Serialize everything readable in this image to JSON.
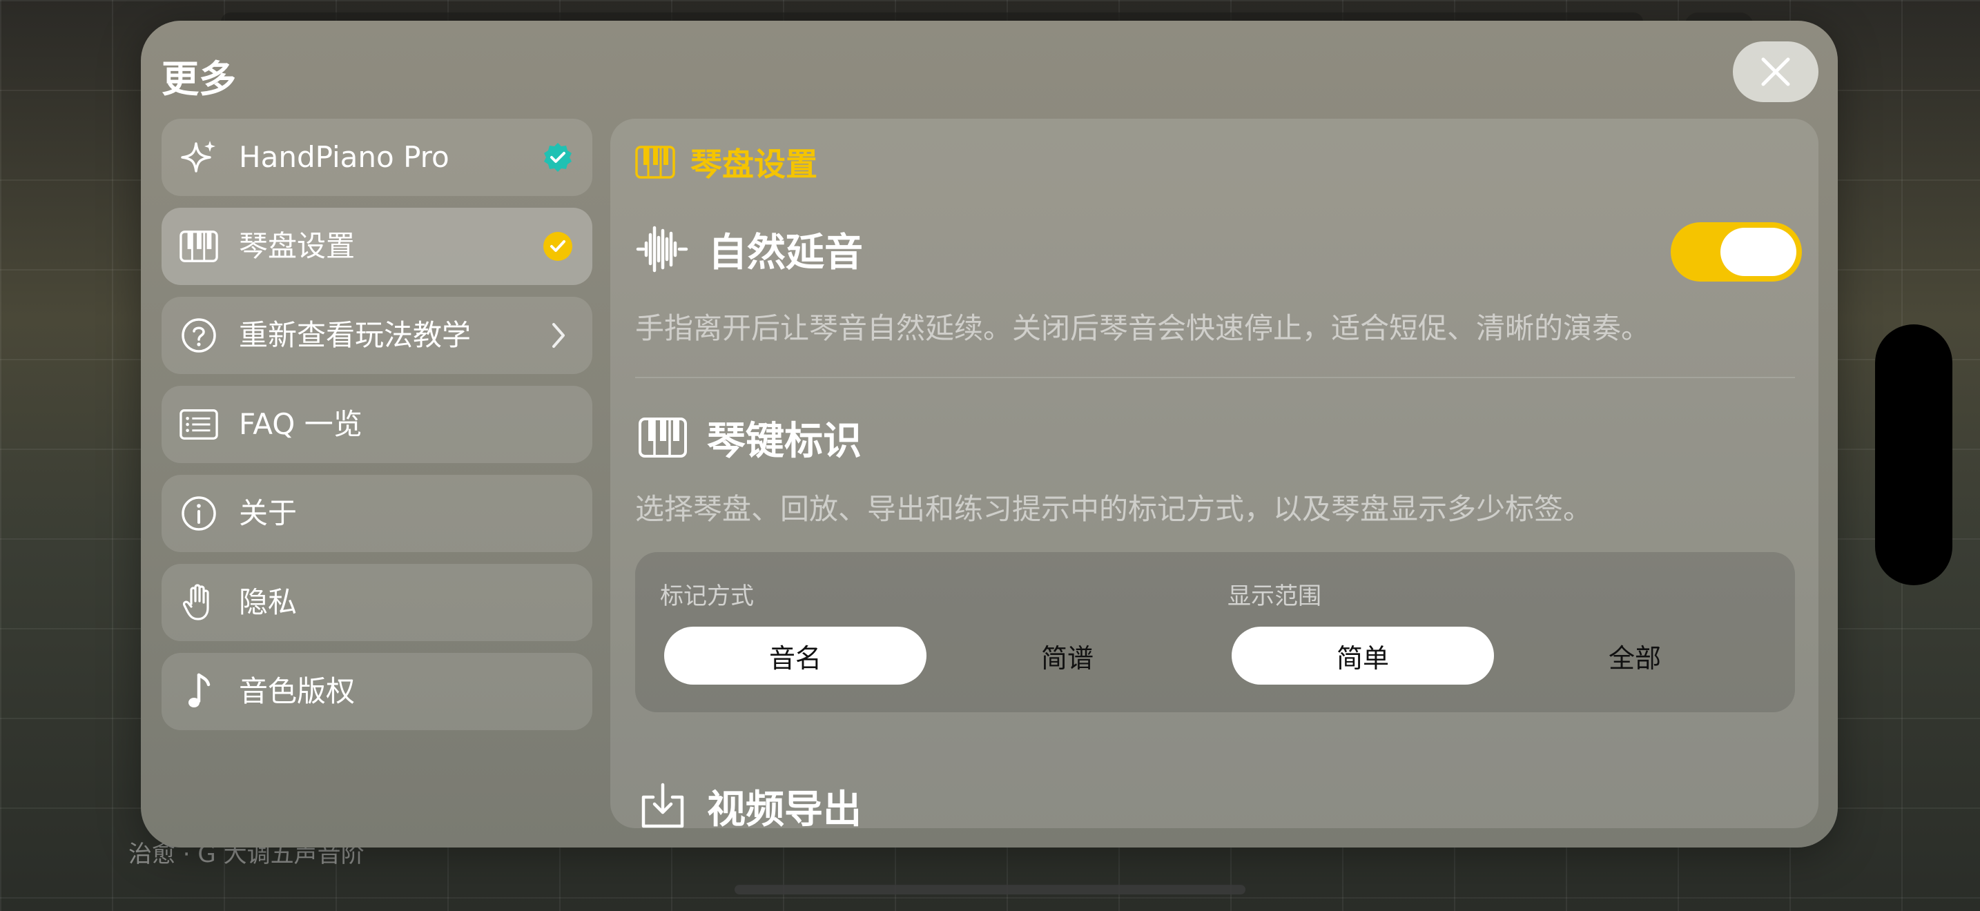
{
  "background": {
    "footer_text": "治愈 · G 大调五声音阶"
  },
  "modal": {
    "title": "更多",
    "close_icon": "close-icon"
  },
  "sidebar": {
    "items": [
      {
        "label": "HandPiano Pro",
        "icon": "sparkle-icon",
        "trail": "verified-badge-icon",
        "trail_color": "#20c1b3"
      },
      {
        "label": "琴盘设置",
        "icon": "piano-keys-icon",
        "trail": "check-circle-icon",
        "trail_color": "#f5c400",
        "active": true
      },
      {
        "label": "重新查看玩法教学",
        "icon": "question-circle-icon",
        "trail": "chevron-right-icon"
      },
      {
        "label": "FAQ 一览",
        "icon": "list-icon"
      },
      {
        "label": "关于",
        "icon": "info-circle-icon"
      },
      {
        "label": "隐私",
        "icon": "hand-icon"
      },
      {
        "label": "音色版权",
        "icon": "music-note-icon"
      }
    ]
  },
  "content": {
    "section_title": "琴盘设置",
    "accent_color": "#f5c400",
    "natural_sustain": {
      "title": "自然延音",
      "description": "手指离开后让琴音自然延续。关闭后琴音会快速停止，适合短促、清晰的演奏。",
      "enabled": true
    },
    "key_labels": {
      "title": "琴键标识",
      "description": "选择琴盘、回放、导出和练习提示中的标记方式，以及琴盘显示多少标签。",
      "mark_style": {
        "label": "标记方式",
        "options": [
          "音名",
          "简谱"
        ],
        "selected": "音名"
      },
      "display_range": {
        "label": "显示范围",
        "options": [
          "简单",
          "全部"
        ],
        "selected": "简单"
      }
    },
    "video_export": {
      "title": "视频导出"
    }
  }
}
